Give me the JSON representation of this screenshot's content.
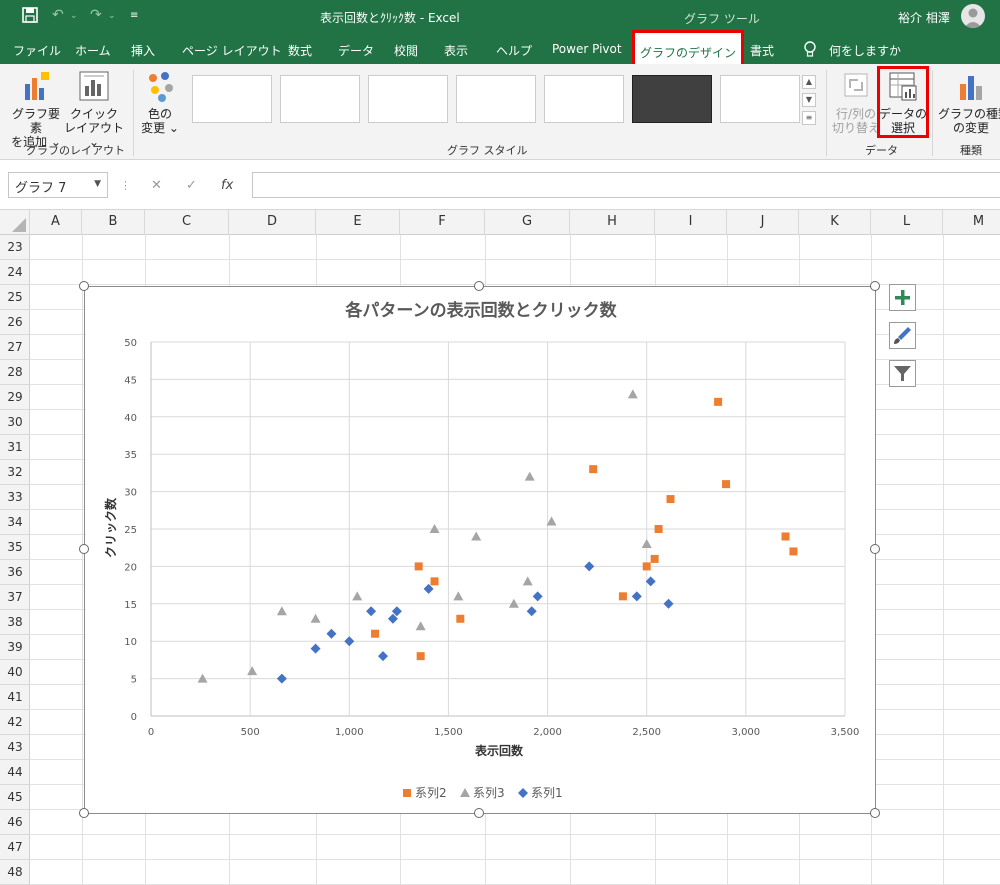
{
  "titlebar": {
    "title": "表示回数とｸﾘｯｸ数  -  Excel",
    "tool_group": "グラフ ツール",
    "user": "裕介 相澤"
  },
  "tabs": {
    "items": [
      "ファイル",
      "ホーム",
      "挿入",
      "ページ レイアウト",
      "数式",
      "データ",
      "校閲",
      "表示",
      "ヘルプ",
      "Power Pivot"
    ],
    "active": "グラフのデザイン",
    "after": [
      "書式"
    ],
    "tell_me": "何をしますか"
  },
  "ribbon": {
    "add_element": [
      "グラフ要素",
      "を追加 ⌄"
    ],
    "quick_layout": [
      "クイック",
      "レイアウト ⌄"
    ],
    "layout_group": "グラフのレイアウト",
    "change_colors": [
      "色の",
      "変更 ⌄"
    ],
    "styles_group": "グラフ スタイル",
    "switch_rowcol": [
      "行/列の",
      "切り替え"
    ],
    "select_data": [
      "データの",
      "選択"
    ],
    "data_group": "データ",
    "change_type": [
      "グラフの種類",
      "の変更"
    ],
    "type_group": "種類"
  },
  "formula_bar": {
    "name_box": "グラフ 7",
    "fx": "fx",
    "formula": ""
  },
  "grid": {
    "columns": [
      "A",
      "B",
      "C",
      "D",
      "E",
      "F",
      "G",
      "H",
      "I",
      "J",
      "K",
      "L",
      "M"
    ],
    "rows": [
      "23",
      "24",
      "25",
      "26",
      "27",
      "28",
      "29",
      "30",
      "31",
      "32",
      "33",
      "34",
      "35",
      "36",
      "37",
      "38",
      "39",
      "40",
      "41",
      "42",
      "43",
      "44",
      "45",
      "46",
      "47",
      "48"
    ]
  },
  "chart_data": {
    "type": "scatter",
    "title": "各パターンの表示回数とクリック数",
    "xlabel": "表示回数",
    "ylabel": "クリック数",
    "xlim": [
      0,
      3500
    ],
    "ylim": [
      0,
      50
    ],
    "xticks": [
      "0",
      "500",
      "1,000",
      "1,500",
      "2,000",
      "2,500",
      "3,000",
      "3,500"
    ],
    "yticks": [
      "0",
      "5",
      "10",
      "15",
      "20",
      "25",
      "30",
      "35",
      "40",
      "45",
      "50"
    ],
    "grid": true,
    "legend_position": "bottom",
    "series": [
      {
        "name": "系列2",
        "color": "#ED7D31",
        "marker": "square",
        "points": [
          [
            1130,
            11
          ],
          [
            1350,
            20
          ],
          [
            1360,
            8
          ],
          [
            1430,
            18
          ],
          [
            1560,
            13
          ],
          [
            2230,
            33
          ],
          [
            2380,
            16
          ],
          [
            2500,
            20
          ],
          [
            2540,
            21
          ],
          [
            2560,
            25
          ],
          [
            2620,
            29
          ],
          [
            2860,
            42
          ],
          [
            2900,
            31
          ],
          [
            3200,
            24
          ],
          [
            3240,
            22
          ]
        ]
      },
      {
        "name": "系列3",
        "color": "#A5A5A5",
        "marker": "triangle",
        "points": [
          [
            260,
            5
          ],
          [
            510,
            6
          ],
          [
            660,
            14
          ],
          [
            830,
            13
          ],
          [
            1040,
            16
          ],
          [
            1360,
            12
          ],
          [
            1430,
            25
          ],
          [
            1550,
            16
          ],
          [
            1640,
            24
          ],
          [
            1830,
            15
          ],
          [
            1900,
            18
          ],
          [
            1910,
            32
          ],
          [
            2020,
            26
          ],
          [
            2430,
            43
          ],
          [
            2500,
            23
          ]
        ]
      },
      {
        "name": "系列1",
        "color": "#4472C4",
        "marker": "diamond",
        "points": [
          [
            660,
            5
          ],
          [
            830,
            9
          ],
          [
            910,
            11
          ],
          [
            1000,
            10
          ],
          [
            1110,
            14
          ],
          [
            1170,
            8
          ],
          [
            1220,
            13
          ],
          [
            1240,
            14
          ],
          [
            1400,
            17
          ],
          [
            1920,
            14
          ],
          [
            1950,
            16
          ],
          [
            2210,
            20
          ],
          [
            2450,
            16
          ],
          [
            2520,
            18
          ],
          [
            2610,
            15
          ]
        ]
      }
    ]
  }
}
